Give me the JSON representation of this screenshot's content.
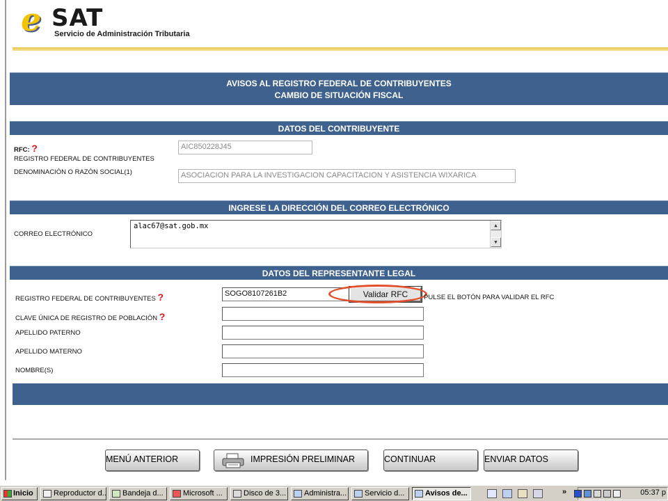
{
  "header": {
    "logo_text": "SAT",
    "logo_subtitle": "Servicio de Administración Tributaria"
  },
  "title": {
    "line1": "AVISOS AL REGISTRO FEDERAL DE CONTRIBUYENTES",
    "line2": "CAMBIO DE SITUACIÓN FISCAL"
  },
  "contribuyente": {
    "section": "DATOS DEL CONTRIBUYENTE",
    "rfc_label": "RFC:",
    "rfc_sublabel": "REGISTRO FEDERAL DE CONTRIBUYENTES",
    "rfc_value": "AIC850228J45",
    "razon_label": "DENOMINACIÓN O RAZÓN SOCIAL(1)",
    "razon_value": "ASOCIACION PARA LA INVESTIGACION CAPACITACION Y ASISTENCIA WIXARICA"
  },
  "correo": {
    "section": "INGRESE LA DIRECCIÓN DEL CORREO ELECTRÓNICO",
    "label": "CORREO ELECTRÓNICO",
    "value": "alac67@sat.gob.mx"
  },
  "representante": {
    "section": "DATOS DEL REPRESENTANTE LEGAL",
    "rfc_label": "REGISTRO FEDERAL DE CONTRIBUYENTES",
    "rfc_value": "SOGO8107261B2",
    "validar_button": "Validar RFC",
    "validar_hint": "PULSE EL BOTÓN PARA VALIDAR EL RFC",
    "curp_label": "CLAVE ÚNICA DE REGISTRO DE POBLACIÓN",
    "apellido_paterno_label": "APELLIDO PATERNO",
    "apellido_materno_label": "APELLIDO MATERNO",
    "nombre_label": "NOMBRE(S)"
  },
  "help_mark": "?",
  "buttons": {
    "menu_anterior": "MENÚ ANTERIOR",
    "impresion": "IMPRESIÓN PRELIMINAR",
    "continuar": "CONTINUAR",
    "enviar": "ENVIAR DATOS"
  },
  "taskbar": {
    "start": "Inicio",
    "items": [
      "Reproductor d...",
      "Bandeja d...",
      "Microsoft ...",
      "Disco de 3...",
      "Administra...",
      "Servicio d...",
      "Avisos de..."
    ],
    "clock": "05:37 p"
  }
}
